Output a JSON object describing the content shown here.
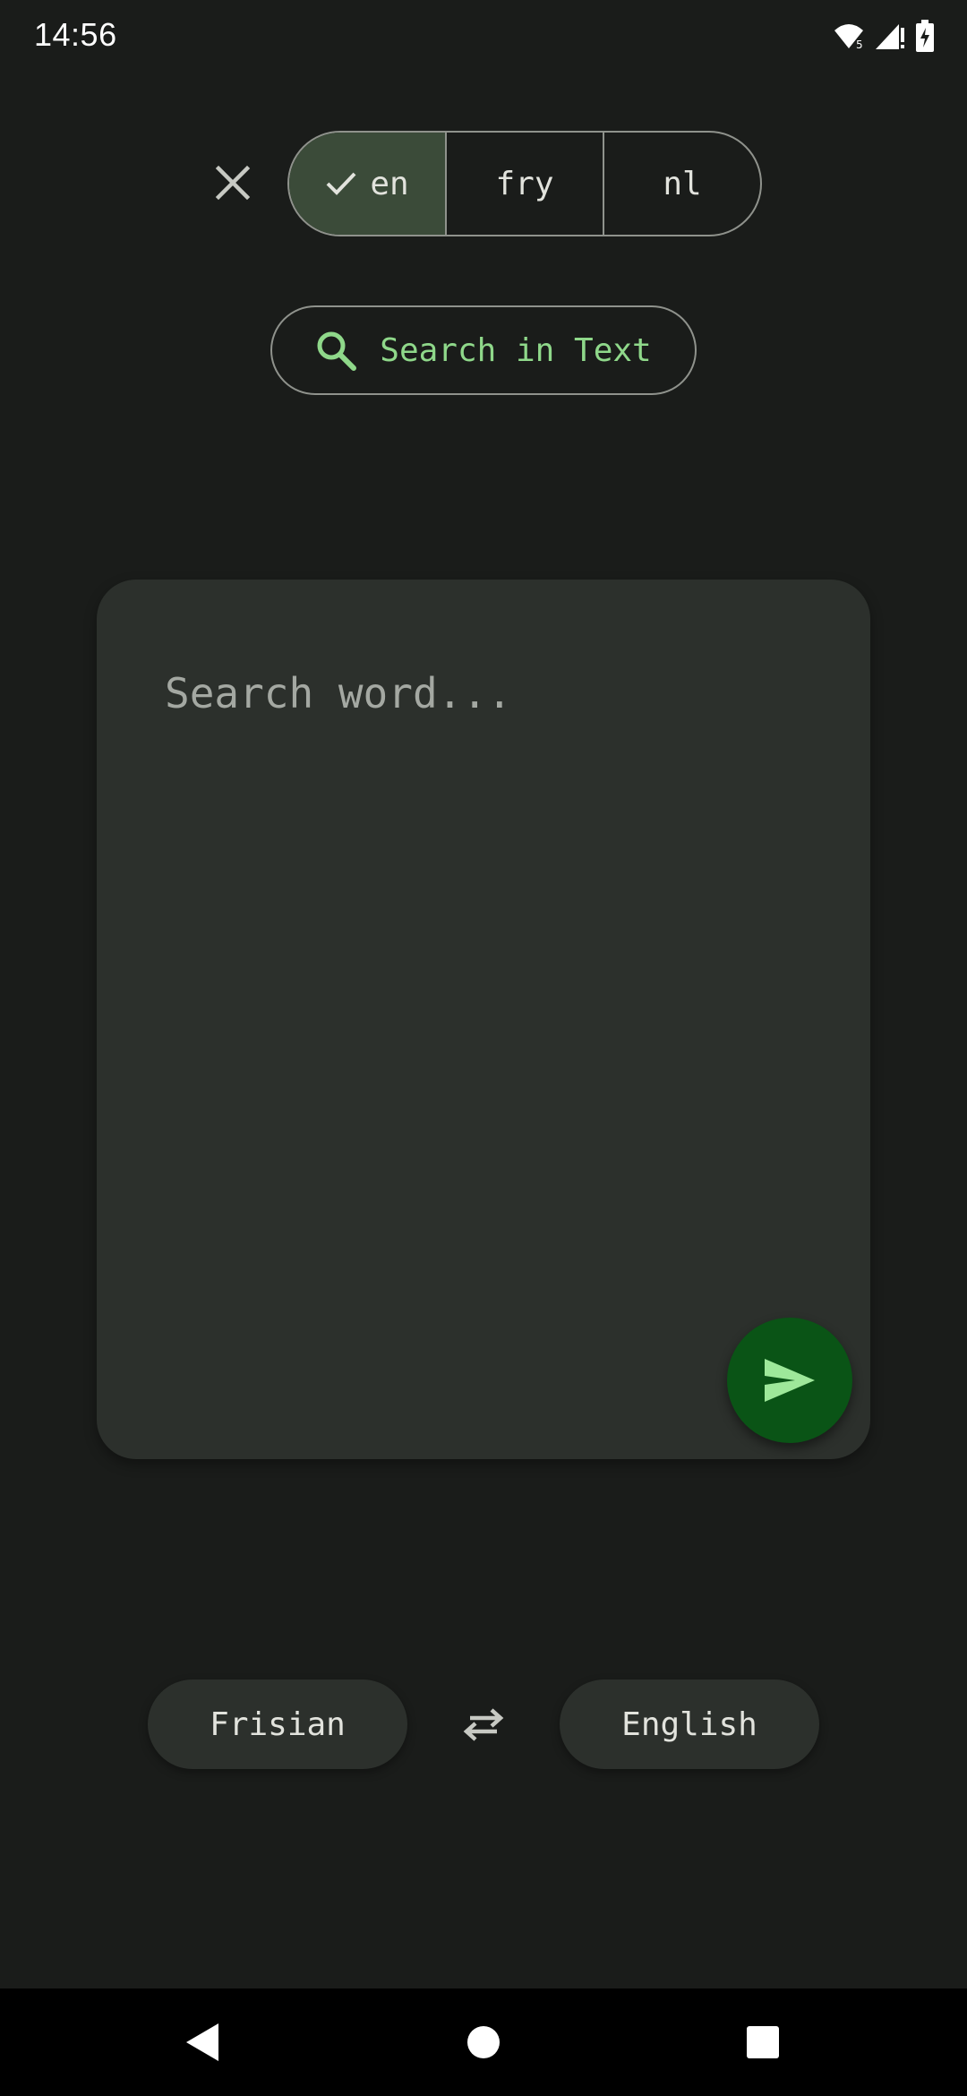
{
  "status_bar": {
    "time": "14:56",
    "icons": [
      "wifi-icon",
      "signal-icon",
      "battery-charging-icon"
    ]
  },
  "language_filter": {
    "options": [
      {
        "label": "en",
        "selected": true
      },
      {
        "label": "fry",
        "selected": false
      },
      {
        "label": "nl",
        "selected": false
      }
    ]
  },
  "search_in_text": {
    "label": "Search in Text"
  },
  "input": {
    "placeholder": "Search word..."
  },
  "languages": {
    "from": "Frisian",
    "to": "English"
  },
  "colors": {
    "background": "#1a1c1a",
    "surface": "#2c302c",
    "accent": "#8fd88a",
    "fab": "#0a5416",
    "selected_segment": "#3b4b39"
  }
}
